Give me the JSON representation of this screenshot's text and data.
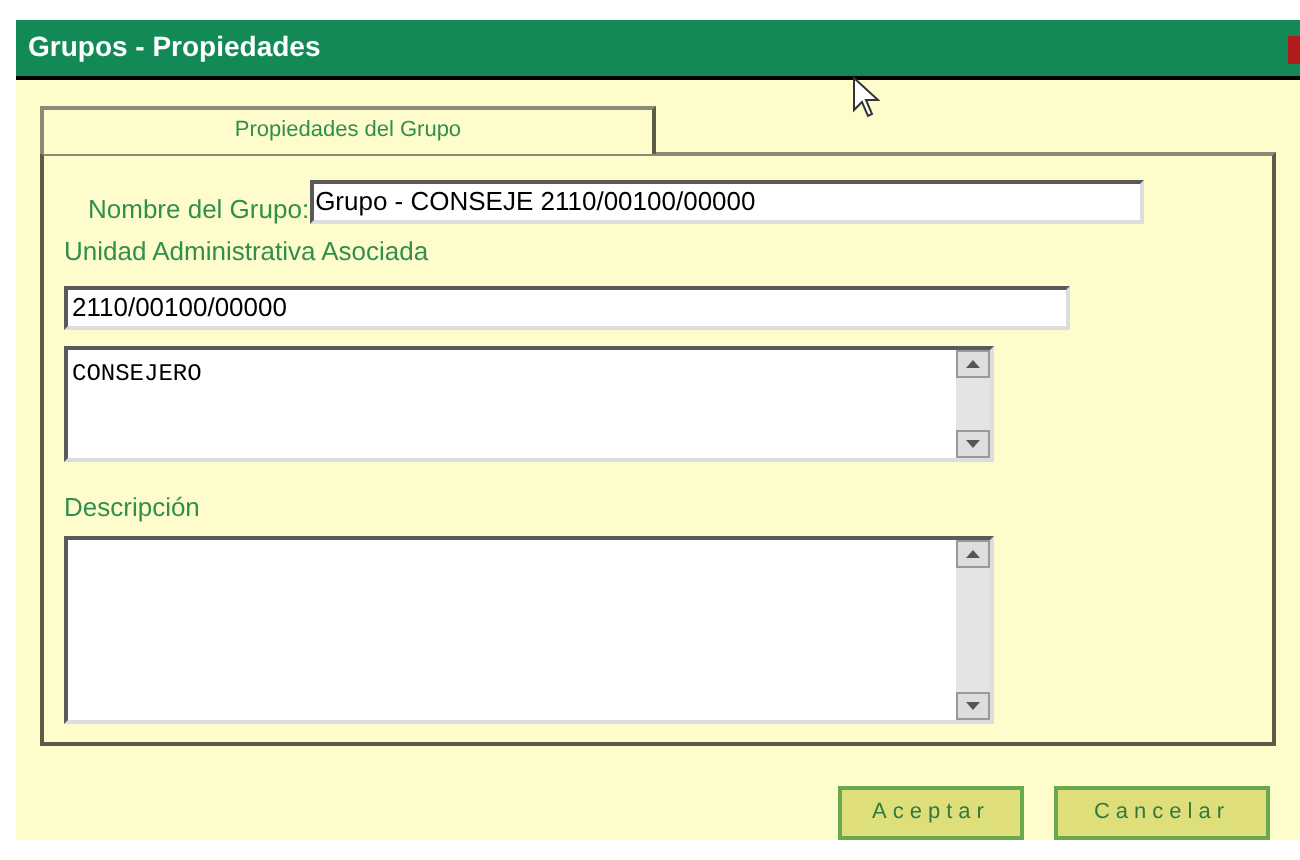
{
  "window": {
    "title": "Grupos - Propiedades"
  },
  "tabs": [
    {
      "label": "Propiedades del Grupo",
      "selected": true
    }
  ],
  "form": {
    "group_name": {
      "label": "Nombre del Grupo:",
      "value": "Grupo - CONSEJE 2110/00100/00000"
    },
    "admin_unit": {
      "label": "Unidad Administrativa Asociada",
      "value": "2110/00100/00000",
      "detail": "CONSEJERO"
    },
    "description": {
      "label": "Descripción"
    }
  },
  "buttons": [
    "Aceptar",
    "Cancelar"
  ]
}
